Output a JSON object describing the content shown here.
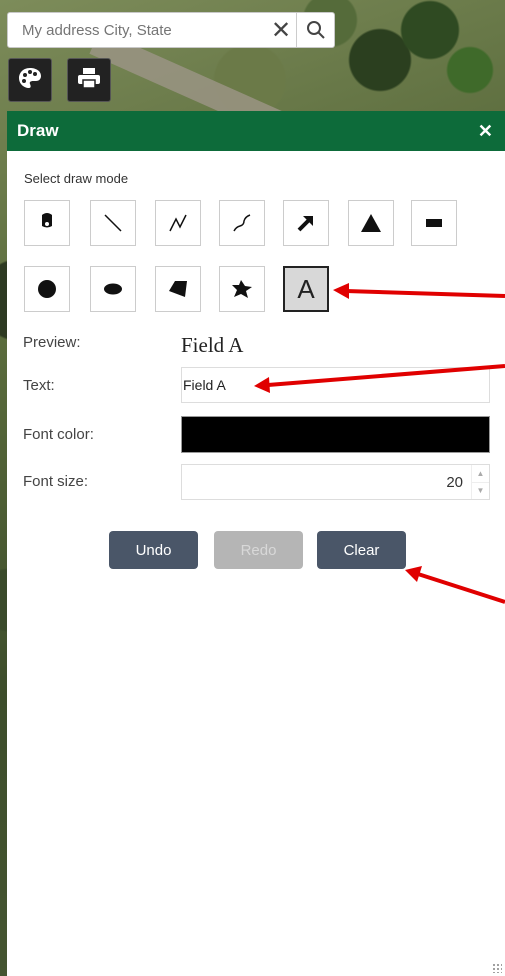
{
  "search": {
    "placeholder": "My address City, State",
    "clear_glyph": "✕"
  },
  "map_tools": [
    {
      "name": "palette-icon"
    },
    {
      "name": "printer-icon"
    }
  ],
  "draw_panel": {
    "title": "Draw",
    "close_glyph": "✕",
    "mode_label": "Select draw mode",
    "modes": [
      {
        "name": "point",
        "icon": "point-icon"
      },
      {
        "name": "line",
        "icon": "line-icon"
      },
      {
        "name": "polyline",
        "icon": "polyline-icon"
      },
      {
        "name": "freehand-polyline",
        "icon": "freehand-line-icon"
      },
      {
        "name": "arrow",
        "icon": "arrow-icon"
      },
      {
        "name": "triangle",
        "icon": "triangle-icon"
      },
      {
        "name": "rectangle",
        "icon": "rectangle-icon"
      },
      {
        "name": "circle",
        "icon": "circle-icon"
      },
      {
        "name": "ellipse",
        "icon": "ellipse-icon"
      },
      {
        "name": "polygon",
        "icon": "polygon-icon"
      },
      {
        "name": "freehand-polygon",
        "icon": "freehand-polygon-icon"
      },
      {
        "name": "text",
        "icon": "text-icon",
        "glyph": "A",
        "active": true
      }
    ],
    "preview_label": "Preview:",
    "preview_value": "Field A",
    "text_label": "Text:",
    "text_value": "Field A",
    "font_color_label": "Font color:",
    "font_color_value": "#000000",
    "font_size_label": "Font size:",
    "font_size_value": "20",
    "buttons": {
      "undo": "Undo",
      "redo": "Redo",
      "clear": "Clear"
    }
  },
  "colors": {
    "header_green": "#0d6b3a",
    "button_dark": "#4a5668",
    "button_disabled": "#b5b5b5",
    "annotation_red": "#e00000"
  }
}
